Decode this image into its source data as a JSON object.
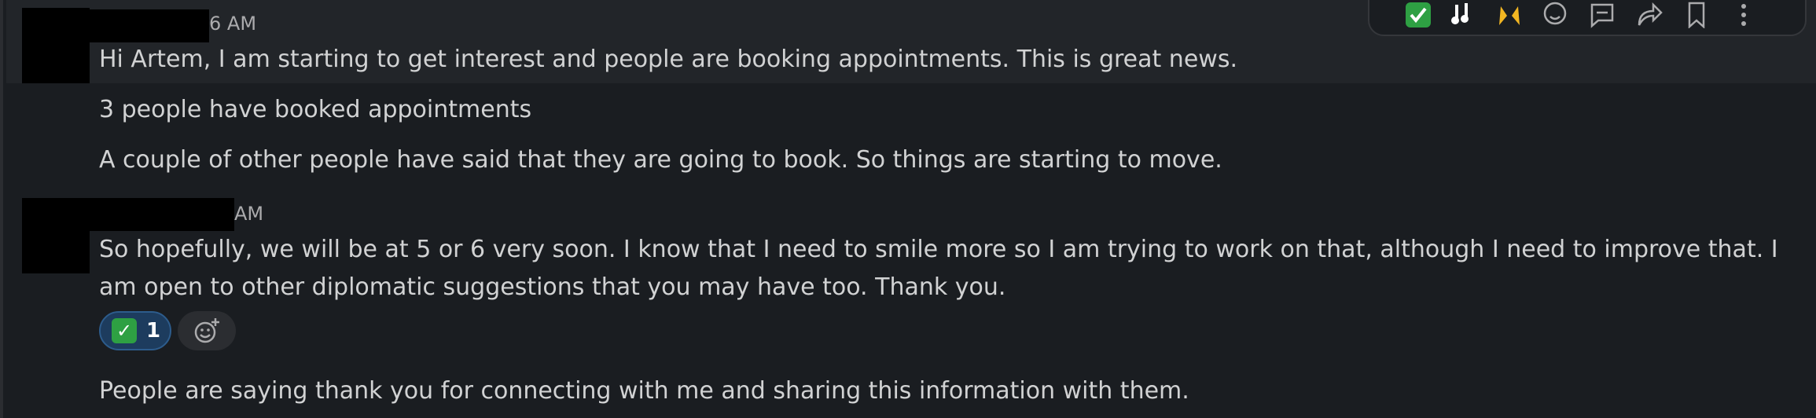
{
  "messages": [
    {
      "time": "6 AM",
      "lines": [
        "Hi Artem, I am starting to get interest and people are booking appointments.  This is great news.",
        "3 people have booked appointments",
        "A couple of other people have said that they are going to book. So things are starting to move."
      ]
    },
    {
      "time": "AM",
      "lines": [
        "So hopefully, we will be at 5 or 6 very soon.  I know that I need to smile more so I am trying to work on that, although I need to improve that.  I am open to other diplomatic suggestions that you may have too.  Thank you.",
        "People are saying thank you for connecting with me and sharing this information with them."
      ],
      "reaction": {
        "emoji": "white-check-mark",
        "count": "1"
      }
    }
  ],
  "toolbar": {
    "icons": [
      "check-mark-emoji-icon",
      "musical-notes-emoji-icon",
      "raised-hands-emoji-icon",
      "add-reaction-icon",
      "reply-in-thread-icon",
      "forward-icon",
      "bookmark-icon",
      "more-actions-icon"
    ]
  },
  "colors": {
    "background": "#1a1d21",
    "hover": "#222529",
    "text": "#d1d2d3",
    "reaction_bg": "#1d3c5e",
    "reaction_border": "#2d5c8c",
    "check_green": "#2ea043"
  }
}
